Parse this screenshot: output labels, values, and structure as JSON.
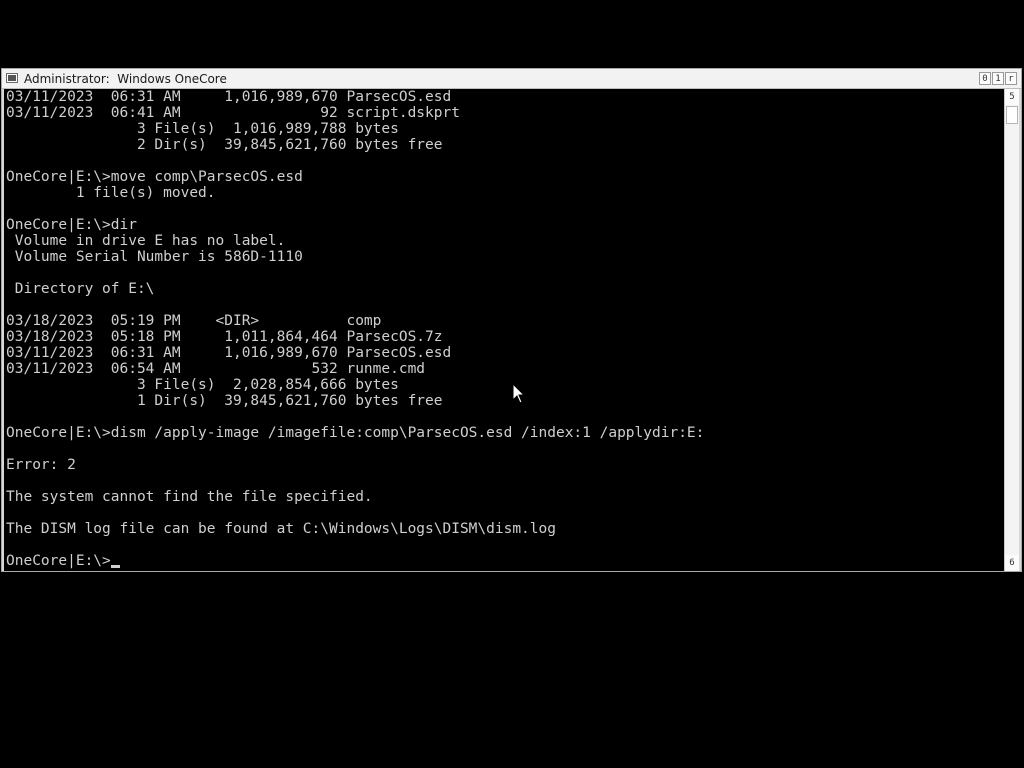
{
  "window": {
    "title": "Administrator:  Windows OneCore",
    "controls": [
      "0",
      "1",
      "r"
    ]
  },
  "console": {
    "lines": [
      "03/11/2023  06:31 AM     1,016,989,670 ParsecOS.esd",
      "03/11/2023  06:41 AM                92 script.dskprt",
      "               3 File(s)  1,016,989,788 bytes",
      "               2 Dir(s)  39,845,621,760 bytes free",
      "",
      "OneCore|E:\\>move comp\\ParsecOS.esd",
      "        1 file(s) moved.",
      "",
      "OneCore|E:\\>dir",
      " Volume in drive E has no label.",
      " Volume Serial Number is 586D-1110",
      "",
      " Directory of E:\\",
      "",
      "03/18/2023  05:19 PM    <DIR>          comp",
      "03/18/2023  05:18 PM     1,011,864,464 ParsecOS.7z",
      "03/11/2023  06:31 AM     1,016,989,670 ParsecOS.esd",
      "03/11/2023  06:54 AM               532 runme.cmd",
      "               3 File(s)  2,028,854,666 bytes",
      "               1 Dir(s)  39,845,621,760 bytes free",
      "",
      "OneCore|E:\\>dism /apply-image /imagefile:comp\\ParsecOS.esd /index:1 /applydir:E:",
      "",
      "Error: 2",
      "",
      "The system cannot find the file specified.",
      "",
      "The DISM log file can be found at C:\\Windows\\Logs\\DISM\\dism.log",
      ""
    ],
    "prompt": "OneCore|E:\\>"
  },
  "scrollbar": {
    "up_glyph": "5",
    "down_glyph": "6"
  },
  "colors": {
    "console_bg": "#000000",
    "console_text": "#cfcfcf",
    "titlebar_bg": "#f2f2f2"
  },
  "icons": {
    "app": "console-window-icon",
    "pointer": "mouse-pointer-icon"
  }
}
